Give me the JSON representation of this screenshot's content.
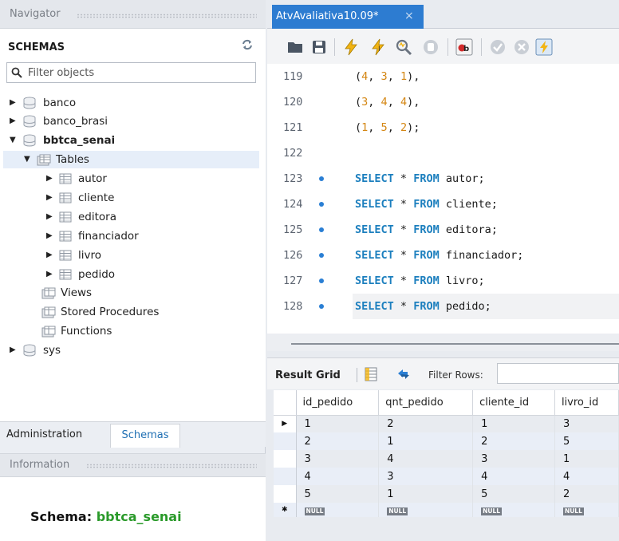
{
  "navigator": {
    "title": "Navigator",
    "schemas_label": "SCHEMAS",
    "filter_placeholder": "Filter objects",
    "databases": [
      {
        "name": "banco"
      },
      {
        "name": "banco_brasi"
      },
      {
        "name": "bbtca_senai"
      },
      {
        "name": "sys"
      }
    ],
    "tables_label": "Tables",
    "tables": [
      "autor",
      "cliente",
      "editora",
      "financiador",
      "livro",
      "pedido"
    ],
    "views_label": "Views",
    "procedures_label": "Stored Procedures",
    "functions_label": "Functions",
    "tabs": {
      "administration": "Administration",
      "schemas": "Schemas"
    },
    "info_title": "Information",
    "schema_label": "Schema:",
    "schema_value": "bbtca_senai"
  },
  "editor": {
    "tab_title": "AtvAvaliativa10.09*",
    "tab_close": "×",
    "lines": [
      {
        "n": "119",
        "tuple": [
          "4",
          "3",
          "1"
        ],
        "end": "),"
      },
      {
        "n": "120",
        "tuple": [
          "3",
          "4",
          "4"
        ],
        "end": "),"
      },
      {
        "n": "121",
        "tuple": [
          "1",
          "5",
          "2"
        ],
        "end": ");"
      },
      {
        "n": "122"
      },
      {
        "n": "123",
        "table": "autor"
      },
      {
        "n": "124",
        "table": "cliente"
      },
      {
        "n": "125",
        "table": "editora"
      },
      {
        "n": "126",
        "table": "financiador"
      },
      {
        "n": "127",
        "table": "livro"
      },
      {
        "n": "128",
        "table": "pedido"
      }
    ],
    "kw_select": "SELECT",
    "kw_star": "*",
    "kw_from": "FROM"
  },
  "results": {
    "result_grid_label": "Result Grid",
    "filter_rows_label": "Filter Rows:",
    "columns": [
      "id_pedido",
      "qnt_pedido",
      "cliente_id",
      "livro_id"
    ],
    "rows": [
      [
        "1",
        "2",
        "1",
        "3"
      ],
      [
        "2",
        "1",
        "2",
        "5"
      ],
      [
        "3",
        "4",
        "3",
        "1"
      ],
      [
        "4",
        "3",
        "4",
        "4"
      ],
      [
        "5",
        "1",
        "5",
        "2"
      ]
    ],
    "null_label": "NULL",
    "current_row_marker": "▶",
    "new_row_marker": "✱"
  },
  "colors": {
    "accent_tab": "#2d7cd1",
    "keyword": "#1c7fbe",
    "number": "#d48612",
    "schema_value": "#2a9a2a"
  }
}
